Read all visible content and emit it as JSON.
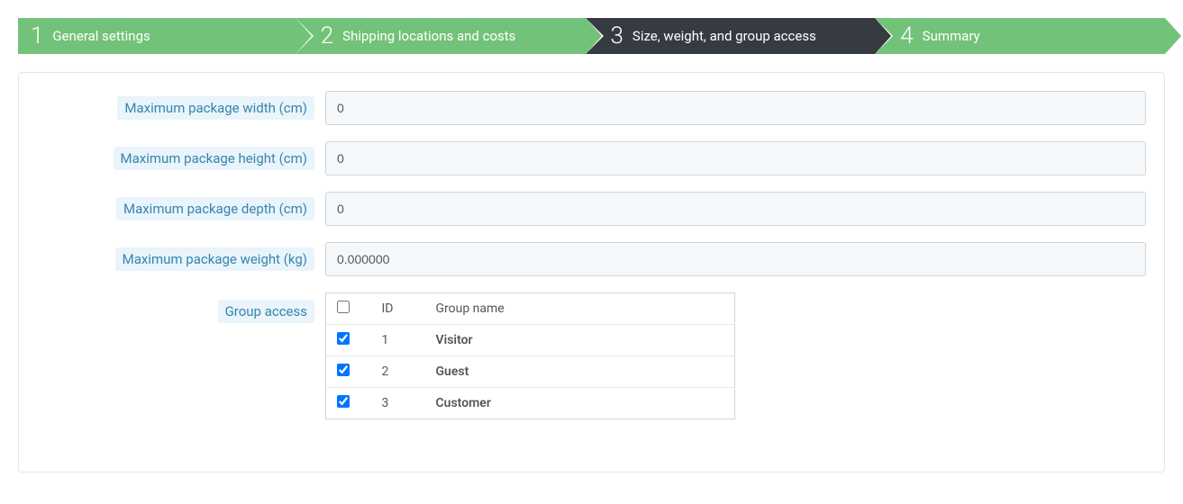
{
  "wizard": {
    "steps": [
      {
        "num": "1",
        "label": "General settings",
        "active": false
      },
      {
        "num": "2",
        "label": "Shipping locations and costs",
        "active": false
      },
      {
        "num": "3",
        "label": "Size, weight, and group access",
        "active": true
      },
      {
        "num": "4",
        "label": "Summary",
        "active": false
      }
    ]
  },
  "form": {
    "width": {
      "label": "Maximum package width (cm)",
      "value": "0"
    },
    "height": {
      "label": "Maximum package height (cm)",
      "value": "0"
    },
    "depth": {
      "label": "Maximum package depth (cm)",
      "value": "0"
    },
    "weight": {
      "label": "Maximum package weight (kg)",
      "value": "0.000000"
    },
    "group_access_label": "Group access"
  },
  "group_table": {
    "headers": {
      "id": "ID",
      "name": "Group name"
    },
    "rows": [
      {
        "id": "1",
        "name": "Visitor",
        "checked": true
      },
      {
        "id": "2",
        "name": "Guest",
        "checked": true
      },
      {
        "id": "3",
        "name": "Customer",
        "checked": true
      }
    ],
    "select_all_checked": false
  }
}
